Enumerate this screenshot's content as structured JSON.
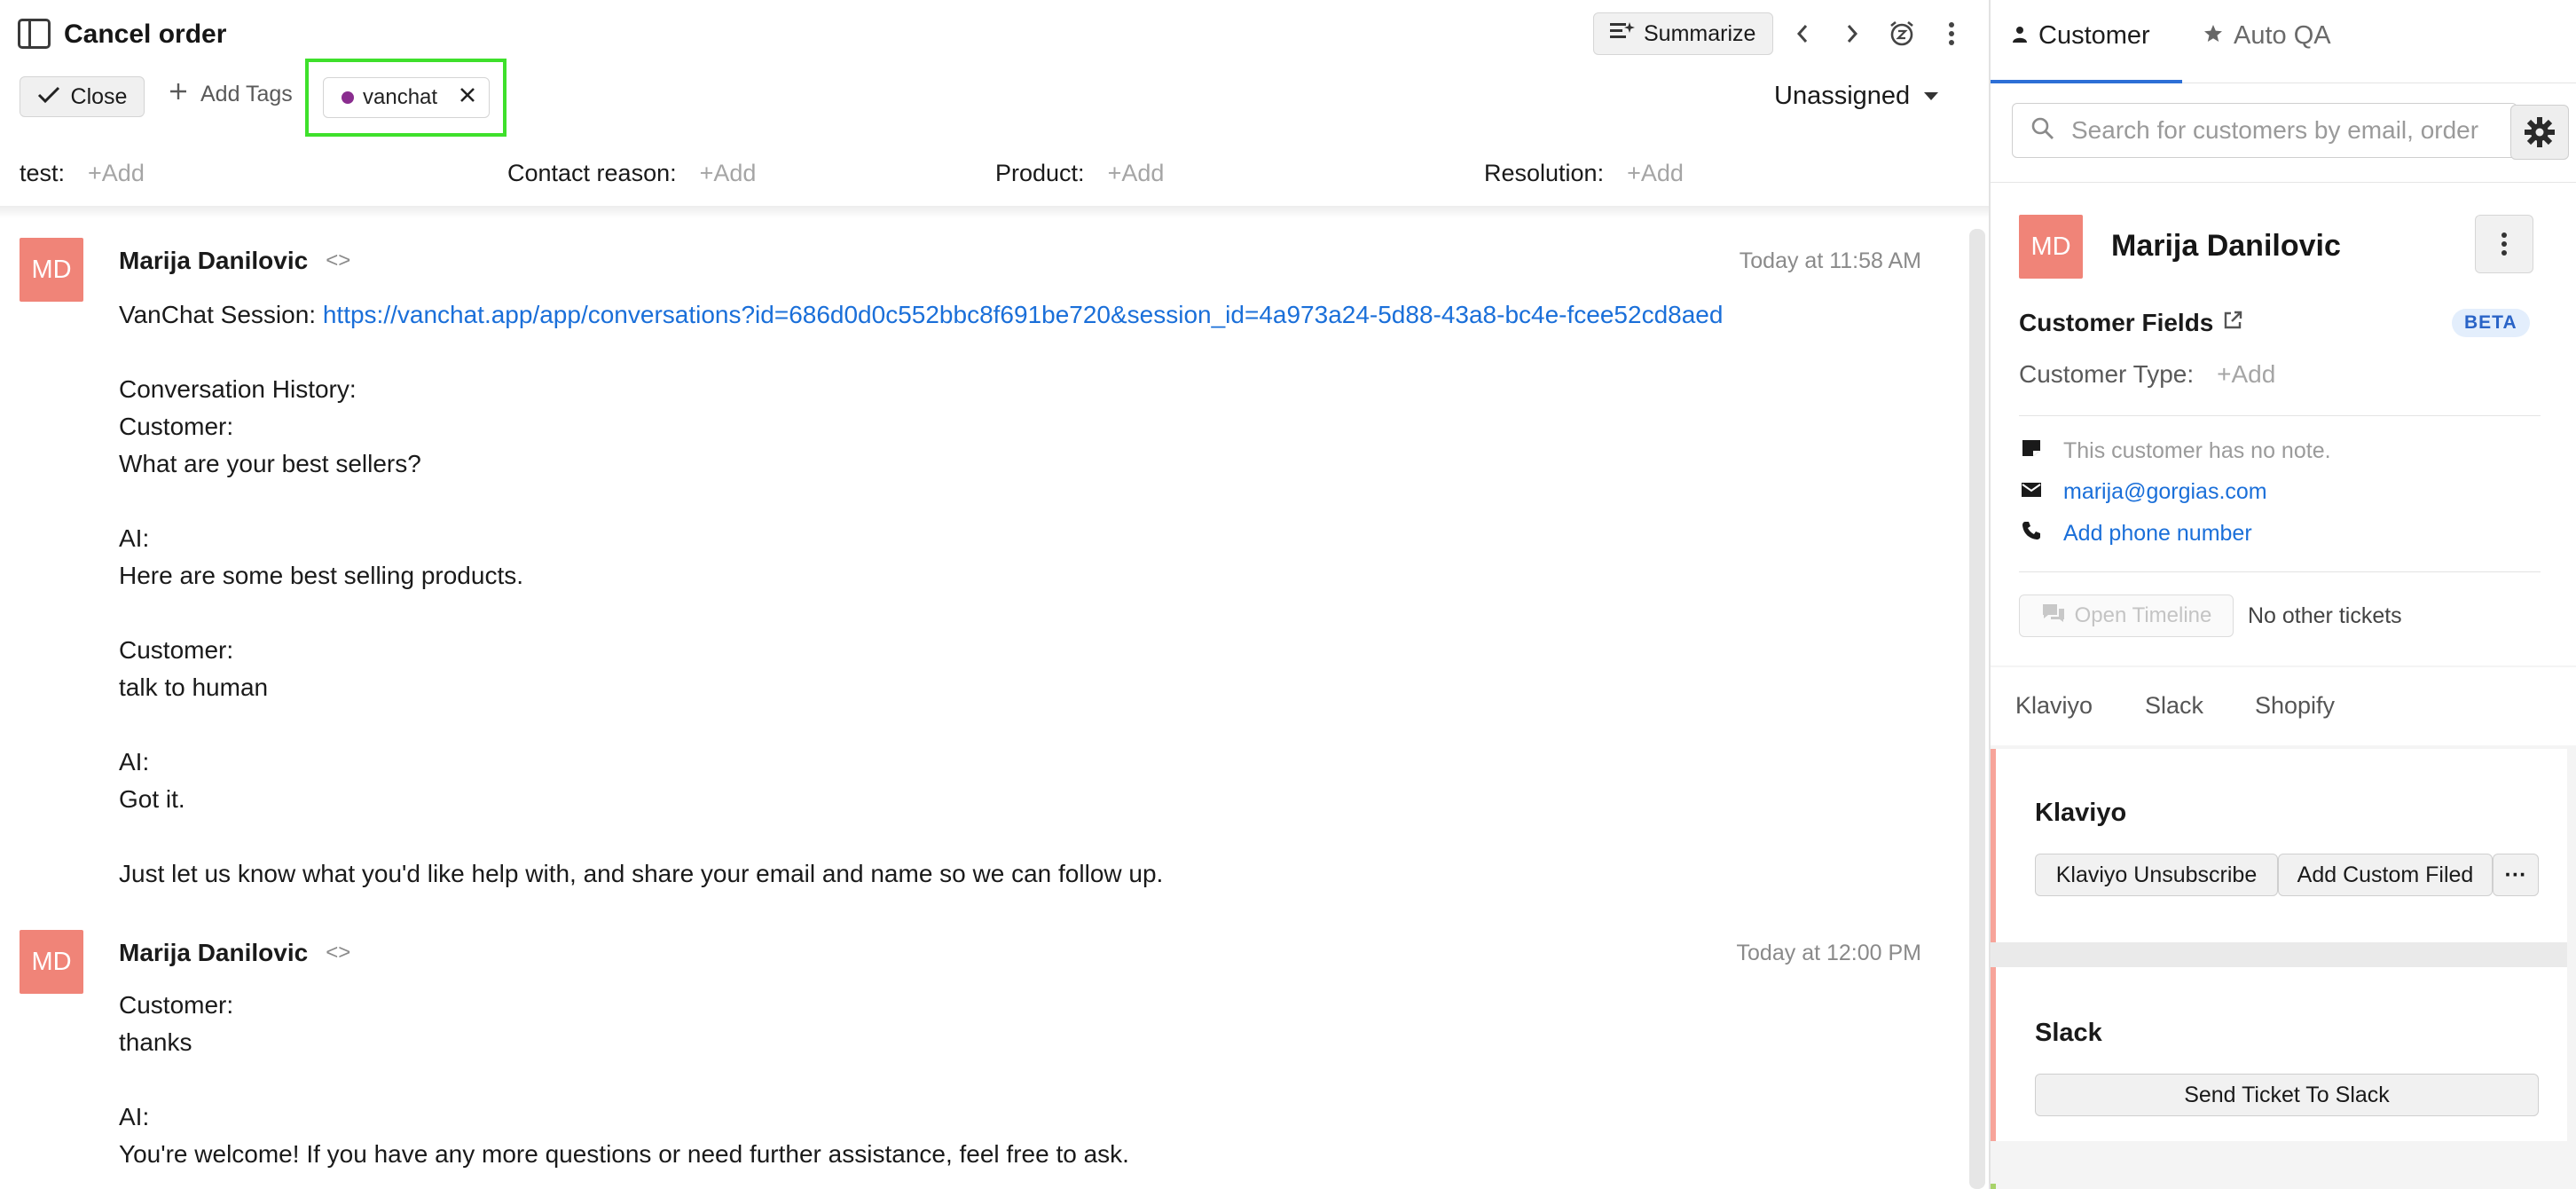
{
  "ticket": {
    "title": "Cancel order",
    "summarize_label": "Summarize",
    "close_label": "Close",
    "add_tags_label": "Add Tags",
    "tag": {
      "label": "vanchat",
      "color": "#8a2d8f"
    },
    "assignee": "Unassigned",
    "highlight_color": "#3ee02b",
    "fields": [
      {
        "label": "test:",
        "value": "+Add"
      },
      {
        "label": "Contact reason:",
        "value": "+Add"
      },
      {
        "label": "Product:",
        "value": "+Add"
      },
      {
        "label": "Resolution:",
        "value": "+Add"
      }
    ],
    "messages": [
      {
        "initials": "MD",
        "author": "Marija Danilovic",
        "time": "Today at 11:58 AM",
        "session_prefix": "VanChat Session: ",
        "session_link": "https://vanchat.app/app/conversations?id=686d0d0c552bbc8f691be720&session_id=4a973a24-5d88-43a8-bc4e-fcee52cd8aed",
        "lines": [
          "Conversation History:",
          "Customer:",
          "What are your best sellers?",
          "",
          "AI:",
          "Here are some best selling products.",
          "",
          "Customer:",
          "talk to human",
          "",
          "AI:",
          "Got it.",
          "",
          "Just let us know what you'd like help with, and share your email and name so we can follow up."
        ]
      },
      {
        "initials": "MD",
        "author": "Marija Danilovic",
        "time": "Today at 12:00 PM",
        "lines": [
          "Customer:",
          "thanks",
          "",
          "AI:",
          "You're welcome! If you have any more questions or need further assistance, feel free to ask."
        ]
      }
    ]
  },
  "sidepanel": {
    "tabs": [
      {
        "label": "Customer",
        "icon": "person-icon",
        "active": true
      },
      {
        "label": "Auto QA",
        "icon": "star-icon",
        "active": false
      }
    ],
    "search_placeholder": "Search for customers by email, order",
    "customer": {
      "initials": "MD",
      "name": "Marija Danilovic",
      "fields_title": "Customer Fields",
      "beta_label": "BETA",
      "type_label": "Customer Type:",
      "type_value": "+Add",
      "note": "This customer has no note.",
      "email": "marija@gorgias.com",
      "phone_link": "Add phone number",
      "timeline_label": "Open Timeline",
      "other_tickets": "No other tickets"
    },
    "integration_tabs": [
      "Klaviyo",
      "Slack",
      "Shopify"
    ],
    "klaviyo": {
      "title": "Klaviyo",
      "unsubscribe_label": "Klaviyo Unsubscribe",
      "custom_label": "Add Custom Filed",
      "more_label": "···"
    },
    "slack": {
      "title": "Slack",
      "send_label": "Send Ticket To Slack"
    }
  }
}
